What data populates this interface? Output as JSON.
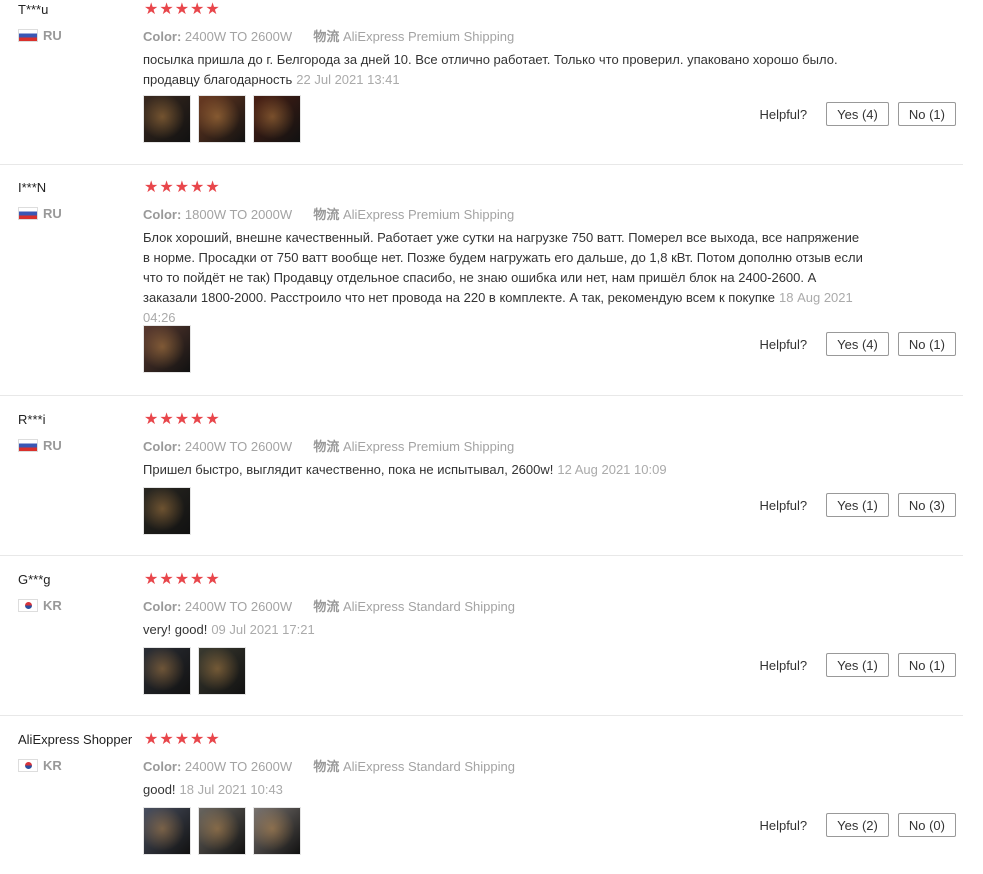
{
  "reviews": [
    {
      "name": "T***u",
      "country": "RU",
      "flag": "ru",
      "rating": "★★★★★",
      "color_label": "Color:",
      "color_value": "2400W TO 2600W",
      "shipping_label": "物流",
      "shipping_value": "AliExpress Premium Shipping",
      "text": "посылка пришла до г. Белгорода за дней 10. Все отлично работает. Только что проверил. упаковано хорошо было. продавцу благодарность",
      "date": "22 Jul 2021 13:41",
      "photos": [
        "#3a2a20",
        "#6a3a22",
        "#4a2015"
      ],
      "helpful_label": "Helpful?",
      "yes": "Yes (4)",
      "no": "No (1)"
    },
    {
      "name": "I***N",
      "country": "RU",
      "flag": "ru",
      "rating": "★★★★★",
      "color_label": "Color:",
      "color_value": "1800W TO 2000W",
      "shipping_label": "物流",
      "shipping_value": "AliExpress Premium Shipping",
      "text": "Блок хороший, внешне качественный. Работает уже сутки на нагрузке 750 ватт. Померел все выхода, все напряжение в норме. Просадки от 750 ватт вообще нет. Позже будем нагружать его дальше, до 1,8 кВт. Потом дополню отзыв если что то пойдёт не так) Продавцу отдельное спасибо, не знаю ошибка или нет, нам пришёл блок на 2400-2600. А заказали 1800-2000. Расстроило что нет провода на 220 в комплекте. А так, рекомендую всем к покупке",
      "date": "18 Aug 2021 04:26",
      "photos": [
        "#5a3a30"
      ],
      "helpful_label": "Helpful?",
      "yes": "Yes (4)",
      "no": "No (1)"
    },
    {
      "name": "R***i",
      "country": "RU",
      "flag": "ru",
      "rating": "★★★★★",
      "color_label": "Color:",
      "color_value": "2400W TO 2600W",
      "shipping_label": "物流",
      "shipping_value": "AliExpress Premium Shipping",
      "text": "Пришел быстро, выглядит качественно, пока не испытывал, 2600w!",
      "date": "12 Aug 2021 10:09",
      "photos": [
        "#2a2822"
      ],
      "helpful_label": "Helpful?",
      "yes": "Yes (1)",
      "no": "No (3)"
    },
    {
      "name": "G***g",
      "country": "KR",
      "flag": "kr",
      "rating": "★★★★★",
      "color_label": "Color:",
      "color_value": "2400W TO 2600W",
      "shipping_label": "物流",
      "shipping_value": "AliExpress Standard Shipping",
      "text": "very! good!",
      "date": "09 Jul 2021 17:21",
      "photos": [
        "#2c2f36",
        "#3a3a30"
      ],
      "helpful_label": "Helpful?",
      "yes": "Yes (1)",
      "no": "No (1)"
    },
    {
      "name": "AliExpress Shopper",
      "country": "KR",
      "flag": "kr",
      "rating": "★★★★★",
      "color_label": "Color:",
      "color_value": "2400W TO 2600W",
      "shipping_label": "物流",
      "shipping_value": "AliExpress Standard Shipping",
      "text": "good!",
      "date": "18 Jul 2021 10:43",
      "photos": [
        "#4a5060",
        "#6a6660",
        "#7a7470"
      ],
      "helpful_label": "Helpful?",
      "yes": "Yes (2)",
      "no": "No (0)"
    }
  ]
}
